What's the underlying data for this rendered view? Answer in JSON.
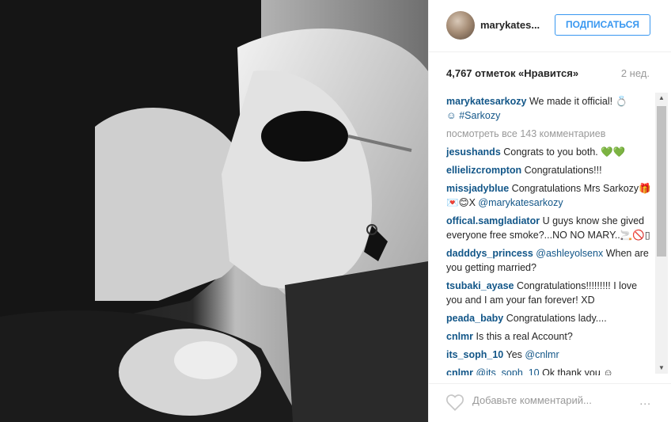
{
  "post": {
    "username": "marykates...",
    "follow_label": "ПОДПИСАТЬСЯ",
    "likes": "4,767 отметок «Нравится»",
    "time": "2 нед."
  },
  "caption": {
    "user": "marykatesarkozy",
    "text": " We made it official! 💍 ",
    "emoji_tag": "☺ #Sarkozy"
  },
  "view_all": "посмотреть все 143 комментариев",
  "comments": [
    {
      "user": "jesushands",
      "text": " Congrats to you both. 💚💚"
    },
    {
      "user": "ellielizcrompton",
      "text": " Congratulations!!!"
    },
    {
      "user": "missjadyblue",
      "text": " Congratulations Mrs Sarkozy🎁💌😊X ",
      "mention": "@marykatesarkozy"
    },
    {
      "user": "offical.samgladiator",
      "text": " U guys know she gived everyone free smoke?...NO NO MARY..🚬🚫▯"
    },
    {
      "user": "dadddys_princess",
      "text": " ",
      "mention": "@ashleyolsenx",
      "after": " When are you getting married?"
    },
    {
      "user": "tsubaki_ayase",
      "text": " Congratulations!!!!!!!!! I love you and I am your fan forever! XD"
    },
    {
      "user": "peada_baby",
      "text": " Congratulations lady...."
    },
    {
      "user": "cnlmr",
      "text": " Is this a real Account?"
    },
    {
      "user": "its_soph_10",
      "text": " Yes ",
      "mention": "@cnlmr"
    },
    {
      "user": "cnlmr",
      "text": " ",
      "mention": "@its_soph_10",
      "after": " Ok thank you ☺"
    }
  ],
  "footer": {
    "add_comment_placeholder": "Добавьте комментарий...",
    "more": "..."
  },
  "icons": {
    "heart": "heart-icon",
    "more": "more-options-icon",
    "scroll_up": "arrow-up-icon",
    "scroll_down": "arrow-down-icon"
  },
  "colors": {
    "accent": "#3897f0",
    "username": "#125688",
    "muted": "#999999"
  }
}
